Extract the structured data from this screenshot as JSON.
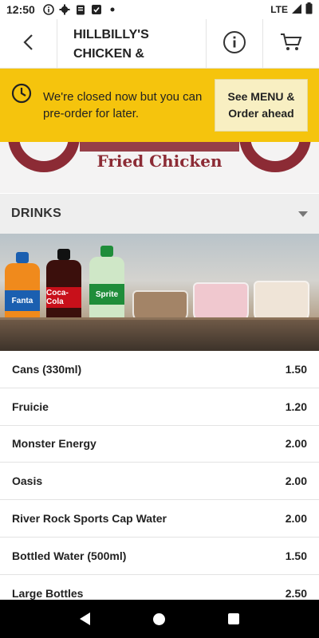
{
  "status_bar": {
    "time": "12:50",
    "network": "LTE",
    "icons": [
      "info-icon",
      "gear-icon",
      "clipboard-icon",
      "notification-icon",
      "dot-icon",
      "wifi-icon",
      "signal-icon",
      "battery-icon"
    ]
  },
  "app_bar": {
    "title": "HILLBILLY'S CHICKEN &",
    "icons": [
      "back-arrow-icon",
      "info-icon",
      "cart-icon"
    ]
  },
  "hero": {
    "brand_text": "Fried Chicken"
  },
  "banner": {
    "message": "We're closed now but you can pre-order for later.",
    "cta": "See MENU & Order ahead",
    "bg_color": "#f5c40d"
  },
  "category": {
    "name": "DRINKS"
  },
  "drinks_image": {
    "bottle_labels": [
      "Fanta",
      "Coca-Cola",
      "Sprite"
    ]
  },
  "menu_items": [
    {
      "name": "Cans (330ml)",
      "price": "1.50"
    },
    {
      "name": "Fruicie",
      "price": "1.20"
    },
    {
      "name": "Monster Energy",
      "price": "2.00"
    },
    {
      "name": "Oasis",
      "price": "2.00"
    },
    {
      "name": "River Rock Sports Cap Water",
      "price": "2.00"
    },
    {
      "name": "Bottled Water (500ml)",
      "price": "1.50"
    },
    {
      "name": "Large Bottles",
      "price": "2.50"
    }
  ]
}
